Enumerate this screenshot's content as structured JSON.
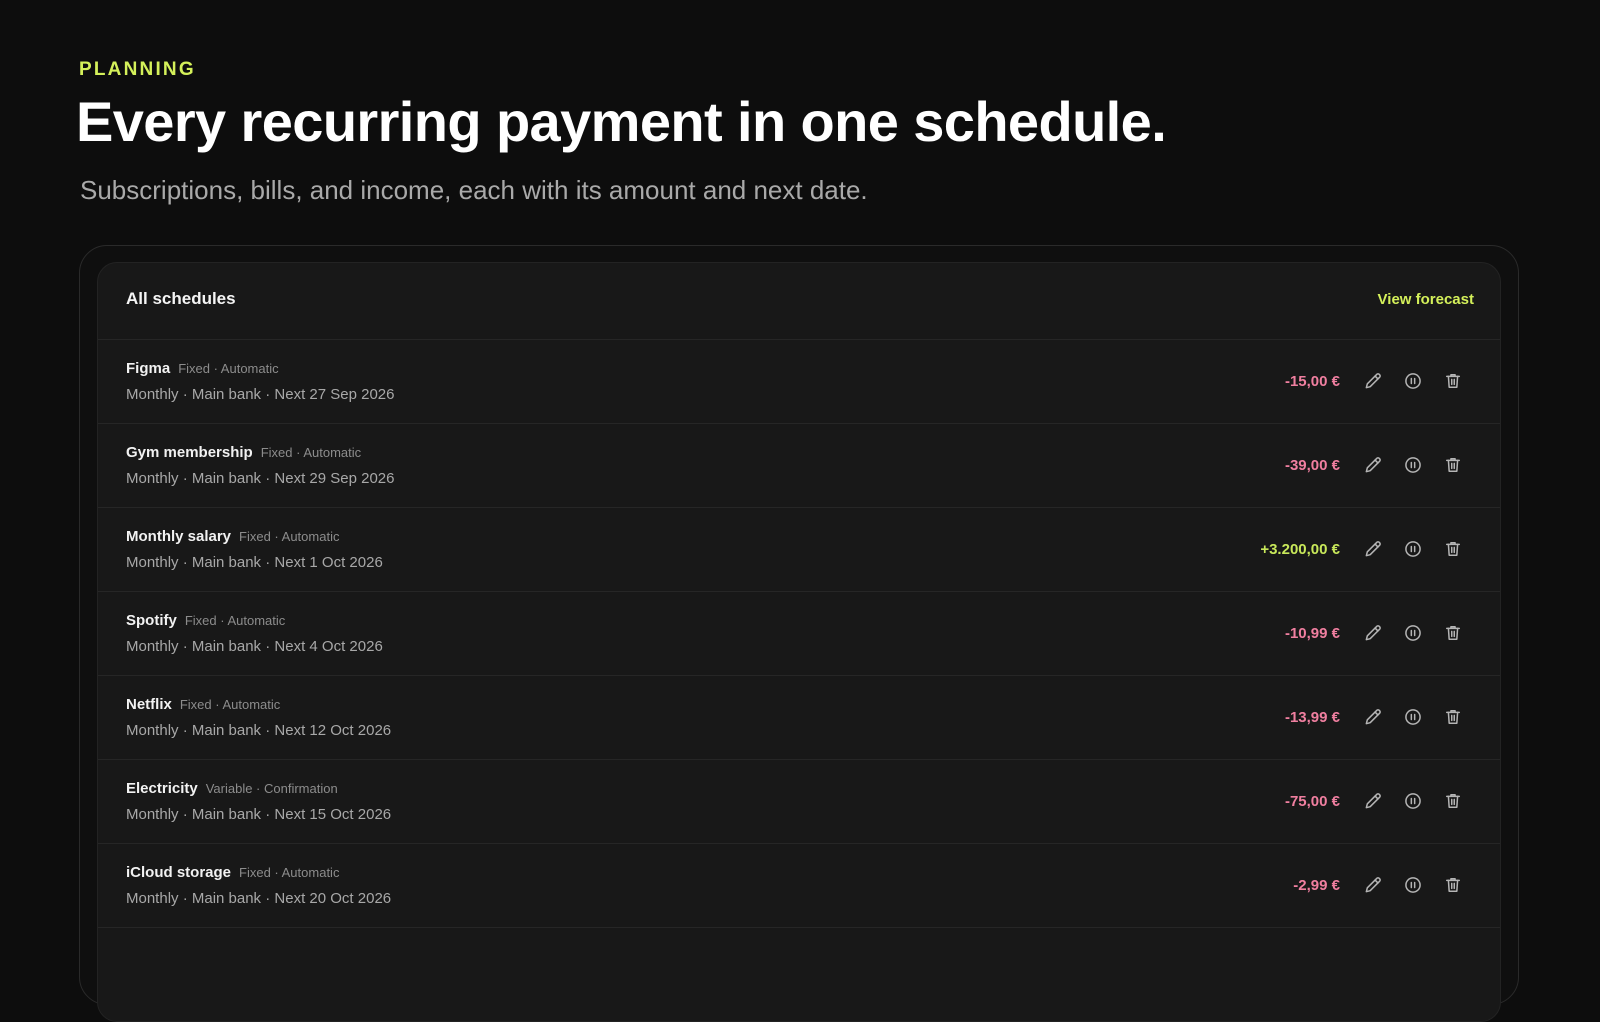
{
  "hero": {
    "eyebrow": "PLANNING",
    "headline": "Every recurring payment in one schedule.",
    "subhead": "Subscriptions, bills, and income, each with its amount and next date."
  },
  "panel": {
    "title": "All schedules",
    "link_label": "View forecast"
  },
  "schedules": [
    {
      "name": "Figma",
      "tags": "Fixed · Automatic",
      "meta": "Monthly · Main bank · Next 27 Sep 2026",
      "amount": "-15,00 €",
      "direction": "out"
    },
    {
      "name": "Gym membership",
      "tags": "Fixed · Automatic",
      "meta": "Monthly · Main bank · Next 29 Sep 2026",
      "amount": "-39,00 €",
      "direction": "out"
    },
    {
      "name": "Monthly salary",
      "tags": "Fixed · Automatic",
      "meta": "Monthly · Main bank · Next 1 Oct 2026",
      "amount": "+3.200,00 €",
      "direction": "in"
    },
    {
      "name": "Spotify",
      "tags": "Fixed · Automatic",
      "meta": "Monthly · Main bank · Next 4 Oct 2026",
      "amount": "-10,99 €",
      "direction": "out"
    },
    {
      "name": "Netflix",
      "tags": "Fixed · Automatic",
      "meta": "Monthly · Main bank · Next 12 Oct 2026",
      "amount": "-13,99 €",
      "direction": "out"
    },
    {
      "name": "Electricity",
      "tags": "Variable · Confirmation",
      "meta": "Monthly · Main bank · Next 15 Oct 2026",
      "amount": "-75,00 €",
      "direction": "out"
    },
    {
      "name": "iCloud storage",
      "tags": "Fixed · Automatic",
      "meta": "Monthly · Main bank · Next 20 Oct 2026",
      "amount": "-2,99 €",
      "direction": "out"
    }
  ],
  "row_actions": [
    {
      "icon": "pencil-icon",
      "name": "edit-button"
    },
    {
      "icon": "pause-icon",
      "name": "pause-button"
    },
    {
      "icon": "trash-icon",
      "name": "delete-button"
    }
  ],
  "colors": {
    "accent": "#d4f05a",
    "expense": "#f07fa0",
    "income": "#c8e85a",
    "background": "#0d0d0d",
    "panel": "#181818"
  }
}
